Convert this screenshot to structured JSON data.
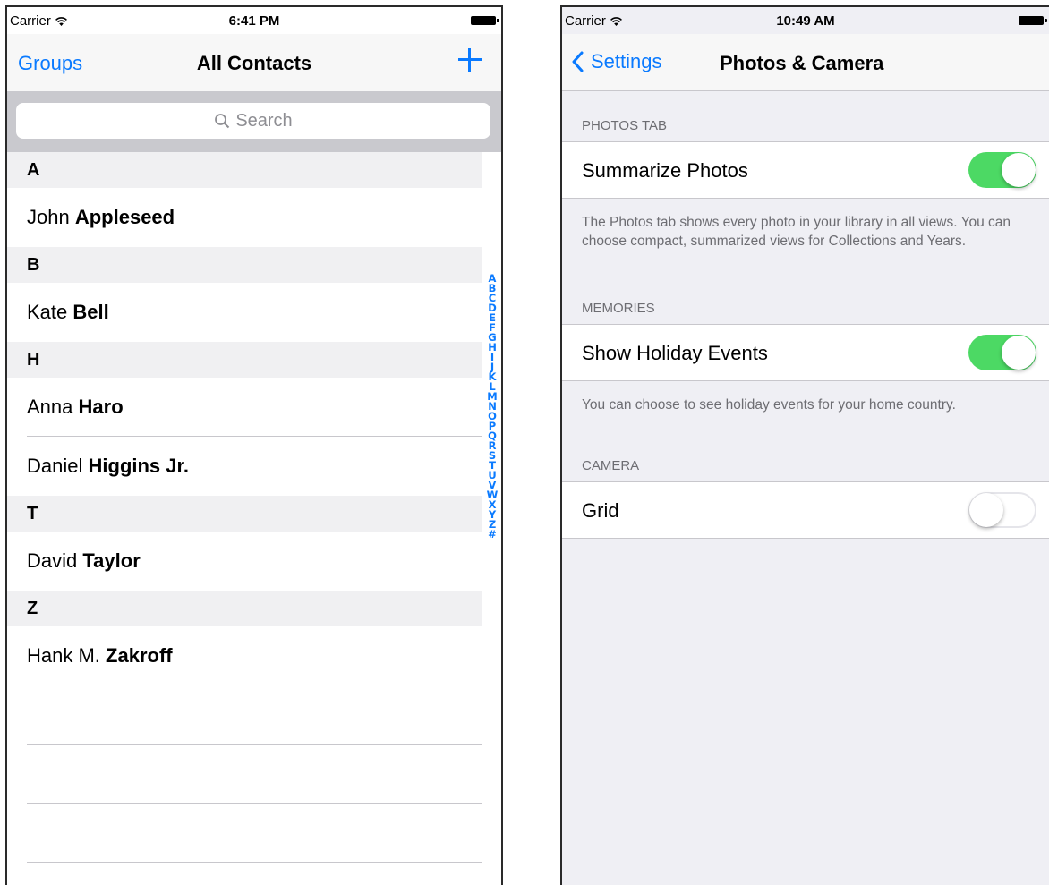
{
  "colors": {
    "accent": "#0a7aff",
    "toggle_on": "#4cd964"
  },
  "left": {
    "status": {
      "carrier": "Carrier",
      "time": "6:41 PM"
    },
    "nav": {
      "groups": "Groups",
      "title": "All Contacts",
      "add_icon": "plus-icon"
    },
    "search": {
      "placeholder": "Search",
      "icon": "search-icon"
    },
    "sections": [
      {
        "letter": "A",
        "contacts": [
          {
            "first": "John",
            "last": "Appleseed"
          }
        ]
      },
      {
        "letter": "B",
        "contacts": [
          {
            "first": "Kate",
            "last": "Bell"
          }
        ]
      },
      {
        "letter": "H",
        "contacts": [
          {
            "first": "Anna",
            "last": "Haro"
          },
          {
            "first": "Daniel",
            "last": "Higgins Jr."
          }
        ]
      },
      {
        "letter": "T",
        "contacts": [
          {
            "first": "David",
            "last": "Taylor"
          }
        ]
      },
      {
        "letter": "Z",
        "contacts": [
          {
            "first": "Hank M.",
            "last": "Zakroff"
          }
        ]
      }
    ],
    "index": [
      "A",
      "B",
      "C",
      "D",
      "E",
      "F",
      "G",
      "H",
      "I",
      "J",
      "K",
      "L",
      "M",
      "N",
      "O",
      "P",
      "Q",
      "R",
      "S",
      "T",
      "U",
      "V",
      "W",
      "X",
      "Y",
      "Z",
      "#"
    ]
  },
  "right": {
    "status": {
      "carrier": "Carrier",
      "time": "10:49 AM"
    },
    "nav": {
      "back": "Settings",
      "title": "Photos & Camera",
      "back_icon": "chevron-left-icon"
    },
    "photos_tab": {
      "header": "PHOTOS TAB",
      "label": "Summarize Photos",
      "enabled": true,
      "footer": "The Photos tab shows every photo in your library in all views. You can choose compact, summarized views for Collections and Years."
    },
    "memories": {
      "header": "MEMORIES",
      "label": "Show Holiday Events",
      "enabled": true,
      "footer": "You can choose to see holiday events for your home country."
    },
    "camera": {
      "header": "CAMERA",
      "label": "Grid",
      "enabled": false
    }
  }
}
